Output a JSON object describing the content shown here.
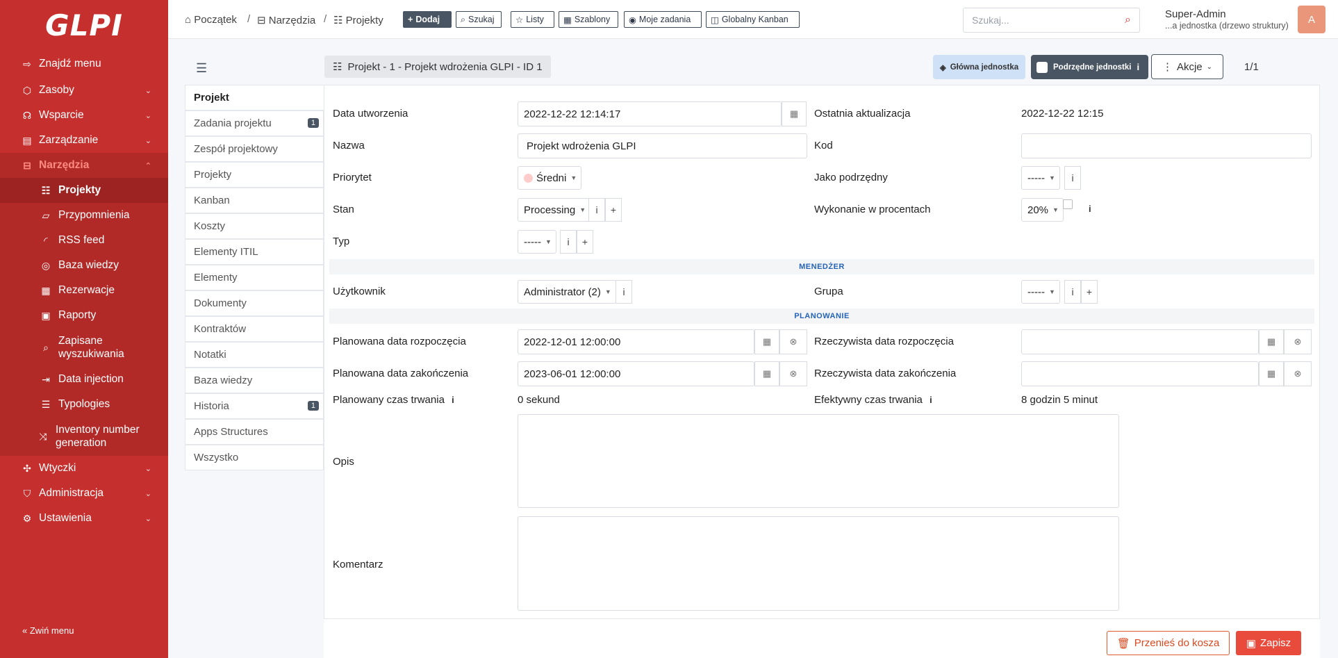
{
  "sidebar": {
    "logo": "GLPI",
    "items": [
      {
        "label": "Znajdź menu",
        "icon": "arrow-right-icon"
      },
      {
        "label": "Zasoby",
        "icon": "cube-icon"
      },
      {
        "label": "Wsparcie",
        "icon": "headset-icon"
      },
      {
        "label": "Zarządzanie",
        "icon": "wallet-icon"
      },
      {
        "label": "Narzędzia",
        "icon": "briefcase-icon"
      },
      {
        "label": "Wtyczki",
        "icon": "puzzle-icon"
      },
      {
        "label": "Administracja",
        "icon": "shield-icon"
      },
      {
        "label": "Ustawienia",
        "icon": "gear-icon"
      }
    ],
    "subitems": [
      {
        "label": "Projekty",
        "icon": "project-icon"
      },
      {
        "label": "Przypomnienia",
        "icon": "note-icon"
      },
      {
        "label": "RSS feed",
        "icon": "rss-icon"
      },
      {
        "label": "Baza wiedzy",
        "icon": "lifebuoy-icon"
      },
      {
        "label": "Rezerwacje",
        "icon": "calendar-icon"
      },
      {
        "label": "Raporty",
        "icon": "report-icon"
      },
      {
        "label": "Zapisane wyszukiwania",
        "icon": "bookmark-icon"
      },
      {
        "label": "Data injection",
        "icon": "file-import-icon"
      },
      {
        "label": "Typologies",
        "icon": "list-check-icon"
      },
      {
        "label": "Inventory number generation",
        "icon": "shuffle-icon"
      }
    ],
    "collapse_label": "Zwiń menu"
  },
  "topbar": {
    "breadcrumb": [
      "Początek",
      "Narzędzia",
      "Projekty"
    ],
    "buttons": {
      "add": "Dodaj",
      "search": "Szukaj",
      "lists": "Listy",
      "templates": "Szablony",
      "my_tasks": "Moje zadania",
      "kanban": "Globalny Kanban"
    },
    "search_placeholder": "Szukaj...",
    "user_name": "Super-Admin",
    "user_entity": "...a jednostka (drzewo struktury)",
    "avatar_letter": "A"
  },
  "header": {
    "record_title": "Projekt - 1 - Projekt wdrożenia GLPI - ID 1",
    "main_entity": "Główna jednostka",
    "sub_entities": "Podrzędne jednostki",
    "actions": "Akcje",
    "pager": "1/1"
  },
  "tabs": [
    {
      "label": "Projekt",
      "badge": ""
    },
    {
      "label": "Zadania projektu",
      "badge": "1"
    },
    {
      "label": "Zespół projektowy",
      "badge": ""
    },
    {
      "label": "Projekty",
      "badge": ""
    },
    {
      "label": "Kanban",
      "badge": ""
    },
    {
      "label": "Koszty",
      "badge": ""
    },
    {
      "label": "Elementy ITIL",
      "badge": ""
    },
    {
      "label": "Elementy",
      "badge": ""
    },
    {
      "label": "Dokumenty",
      "badge": ""
    },
    {
      "label": "Kontraktów",
      "badge": ""
    },
    {
      "label": "Notatki",
      "badge": ""
    },
    {
      "label": "Baza wiedzy",
      "badge": ""
    },
    {
      "label": "Historia",
      "badge": "1"
    },
    {
      "label": "Apps Structures",
      "badge": ""
    },
    {
      "label": "Wszystko",
      "badge": ""
    }
  ],
  "form": {
    "creation_date_label": "Data utworzenia",
    "creation_date": "2022-12-22 12:14:17",
    "last_update_label": "Ostatnia aktualizacja",
    "last_update": "2022-12-22 12:15",
    "name_label": "Nazwa",
    "name": "Projekt wdrożenia GLPI",
    "code_label": "Kod",
    "code": "",
    "priority_label": "Priorytet",
    "priority": "Średni",
    "priority_color": "#ffcccc",
    "as_child_label": "Jako podrzędny",
    "as_child": "-----",
    "state_label": "Stan",
    "state": "Processing",
    "percent_label": "Wykonanie w procentach",
    "percent": "20%",
    "type_label": "Typ",
    "type": "-----",
    "manager_section": "MENEDŻER",
    "user_label": "Użytkownik",
    "user": "Administrator (2)",
    "group_label": "Grupa",
    "group": "-----",
    "planning_section": "PLANOWANIE",
    "plan_start_label": "Planowana data rozpoczęcia",
    "plan_start": "2022-12-01 12:00:00",
    "real_start_label": "Rzeczywista data rozpoczęcia",
    "real_start": "",
    "plan_end_label": "Planowana data zakończenia",
    "plan_end": "2023-06-01 12:00:00",
    "real_end_label": "Rzeczywista data zakończenia",
    "real_end": "",
    "plan_duration_label": "Planowany czas trwania",
    "plan_duration": "0 sekund",
    "effective_duration_label": "Efektywny czas trwania",
    "effective_duration": "8 godzin 5 minut",
    "description_label": "Opis",
    "comment_label": "Komentarz"
  },
  "footer": {
    "trash": "Przenieś do kosza",
    "save": "Zapisz"
  }
}
